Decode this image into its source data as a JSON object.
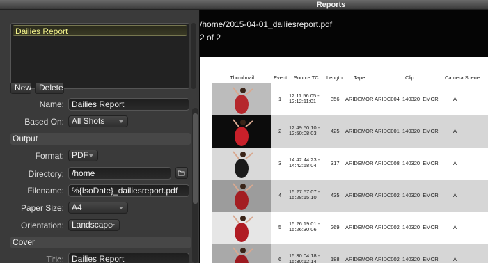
{
  "window": {
    "title": "Reports"
  },
  "left": {
    "reports": [
      "Dailies Report"
    ],
    "new_label": "New",
    "delete_label": "Delete",
    "name_label": "Name:",
    "name_value": "Dailies Report",
    "based_on_label": "Based On:",
    "based_on_value": "All Shots",
    "output_section": "Output",
    "format_label": "Format:",
    "format_value": "PDF",
    "directory_label": "Directory:",
    "directory_value": "/home",
    "filename_label": "Filename:",
    "filename_value": "%{IsoDate}_dailiesreport.pdf",
    "paper_size_label": "Paper Size:",
    "paper_size_value": "A4",
    "orientation_label": "Orientation:",
    "orientation_value": "Landscape",
    "cover_section": "Cover",
    "title_label": "Title:",
    "title_value": "Dailies Report"
  },
  "right": {
    "path": "/home/2015-04-01_dailiesreport.pdf",
    "page": "2 of 2",
    "columns": [
      "Thumbnail",
      "Event",
      "Source TC",
      "Length",
      "Tape",
      "Clip",
      "Camera Scene"
    ],
    "rows": [
      {
        "event": "1",
        "tc_in": "12:11:56:05 -",
        "tc_out": "12:12:11:01",
        "length": "356",
        "tape": "ARIDEMOR",
        "clip": "ARIDC004_140320_EMOR",
        "camera": "A"
      },
      {
        "event": "2",
        "tc_in": "12:49:50:10 -",
        "tc_out": "12:50:08:03",
        "length": "425",
        "tape": "ARIDEMOR",
        "clip": "ARIDC001_140320_EMOR",
        "camera": "A"
      },
      {
        "event": "3",
        "tc_in": "14:42:44:23 -",
        "tc_out": "14:42:58:04",
        "length": "317",
        "tape": "ARIDEMOR",
        "clip": "ARIDC008_140320_EMOR",
        "camera": "A"
      },
      {
        "event": "4",
        "tc_in": "15:27:57:07 -",
        "tc_out": "15:28:15:10",
        "length": "435",
        "tape": "ARIDEMOR",
        "clip": "ARIDC002_140320_EMOR",
        "camera": "A"
      },
      {
        "event": "5",
        "tc_in": "15:26:19:01 -",
        "tc_out": "15:26:30:06",
        "length": "269",
        "tape": "ARIDEMOR",
        "clip": "ARIDC002_140320_EMOR",
        "camera": "A"
      },
      {
        "event": "6",
        "tc_in": "15:30:04:18 -",
        "tc_out": "15:30:12:14",
        "length": "188",
        "tape": "ARIDEMOR",
        "clip": "ARIDC002_140320_EMOR",
        "camera": "A"
      }
    ]
  },
  "colors": {
    "highlight_text": "#f2f28a",
    "panel": "#3a3a3a",
    "section": "#474747"
  }
}
